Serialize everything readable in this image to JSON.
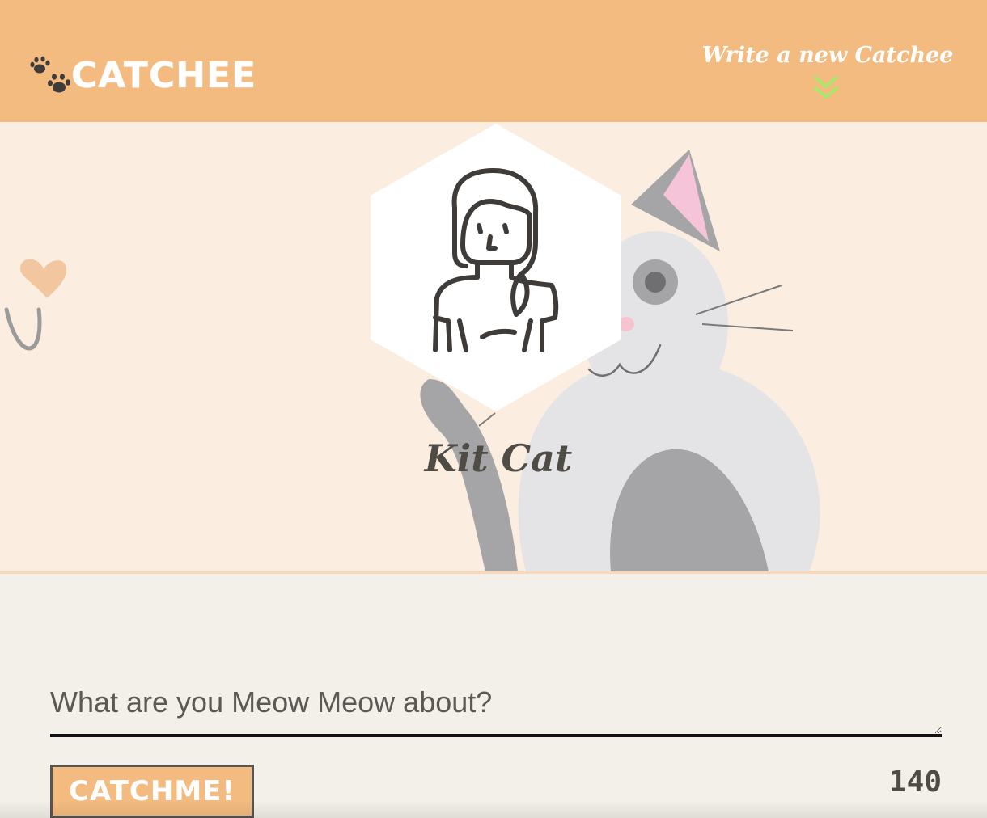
{
  "app": {
    "title": "CATCHEE"
  },
  "nav": {
    "write_new_label": "Write a new Catchee"
  },
  "profile": {
    "name": "Kit Cat"
  },
  "compose": {
    "placeholder": "What are you Meow Meow about?",
    "value": "",
    "submit_label": "CATCHME!",
    "char_count": "140"
  },
  "colors": {
    "nav_background": "#f4bb80",
    "header_background": "#fbeee0",
    "compose_background": "#f3efe9",
    "accent_green": "#a8e86b",
    "text_dark": "#4f4b45"
  }
}
